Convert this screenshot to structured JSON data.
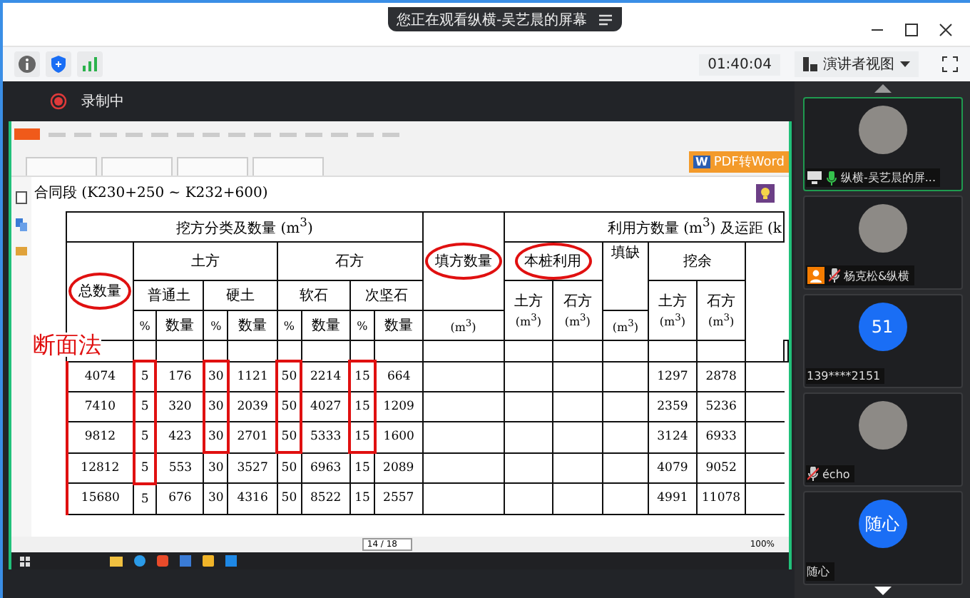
{
  "banner": {
    "text": "您正在观看纵横-吴艺晨的屏幕"
  },
  "toolbar": {
    "timer": "01:40:04",
    "view_button": "演讲者视图"
  },
  "recording": {
    "label": "录制中"
  },
  "shared_screen": {
    "pdf_button": "PDF转Word",
    "pdf_icon": "W",
    "doc_title": "合同段 (K230+250 ~ K232+600)",
    "annotation": "断面法",
    "page": "14 / 18",
    "zoom": "100%",
    "table": {
      "title_excavation": "挖方分类及数量 (m$^{3}$)",
      "title_fill": "填方数量",
      "title_use": "利用方数量 (m$^{3}$) 及运距 (k",
      "total": "总数量",
      "total_circled": true,
      "fill_circled": true,
      "fill_unit": "(m$^{3}$)",
      "groups": [
        {
          "name": "土方",
          "types": [
            {
              "name": "普通土",
              "pct": "%",
              "qty": "数量"
            },
            {
              "name": "硬土",
              "pct": "%",
              "qty": "数量"
            }
          ]
        },
        {
          "name": "石方",
          "types": [
            {
              "name": "软石",
              "pct": "%",
              "qty": "数量"
            },
            {
              "name": "次坚石",
              "pct": "%",
              "qty": "数量"
            }
          ]
        }
      ],
      "use_own": {
        "name": "本桩利用",
        "circled": true,
        "cols": [
          {
            "name": "土方",
            "unit": "(m$^{3}$)"
          },
          {
            "name": "石方",
            "unit": "(m$^{3}$)"
          }
        ]
      },
      "use_gap": {
        "name": "填缺",
        "unit": "(m$^{3}$)"
      },
      "use_surplus": {
        "name": "挖余",
        "cols": [
          {
            "name": "土方",
            "unit": "(m$^{3}$)"
          },
          {
            "name": "石方",
            "unit": "(m$^{3}$)"
          }
        ]
      },
      "rows": [
        {
          "total": "4074",
          "parts": [
            {
              "pct": "5",
              "qty": "176",
              "circled": true
            },
            {
              "pct": "30",
              "qty": "1121",
              "circled": true
            },
            {
              "pct": "50",
              "qty": "2214",
              "circled": true
            },
            {
              "pct": "15",
              "qty": "664",
              "circled": true
            }
          ],
          "surplus": [
            "1297",
            "2878"
          ]
        },
        {
          "total": "7410",
          "parts": [
            {
              "pct": "5",
              "qty": "320",
              "circled": true
            },
            {
              "pct": "30",
              "qty": "2039",
              "circled": true
            },
            {
              "pct": "50",
              "qty": "4027",
              "circled": true
            },
            {
              "pct": "15",
              "qty": "1209",
              "circled": true
            }
          ],
          "surplus": [
            "2359",
            "5236"
          ]
        },
        {
          "total": "9812",
          "parts": [
            {
              "pct": "5",
              "qty": "423",
              "circled": true
            },
            {
              "pct": "30",
              "qty": "2701",
              "circled": true
            },
            {
              "pct": "50",
              "qty": "5333",
              "circled": true
            },
            {
              "pct": "15",
              "qty": "1600",
              "circled": true
            }
          ],
          "surplus": [
            "3124",
            "6933"
          ]
        },
        {
          "total": "12812",
          "parts": [
            {
              "pct": "5",
              "qty": "553",
              "circled": true
            },
            {
              "pct": "30",
              "qty": "3527",
              "circled": false
            },
            {
              "pct": "50",
              "qty": "6963",
              "circled": false
            },
            {
              "pct": "15",
              "qty": "2089",
              "circled": false
            }
          ],
          "surplus": [
            "4079",
            "9052"
          ]
        },
        {
          "total": "15680",
          "parts": [
            {
              "pct": "5",
              "qty": "676",
              "circled": false
            },
            {
              "pct": "30",
              "qty": "4316",
              "circled": false
            },
            {
              "pct": "50",
              "qty": "8522",
              "circled": false
            },
            {
              "pct": "15",
              "qty": "2557",
              "circled": false
            }
          ],
          "surplus": [
            "4991",
            "11078"
          ]
        }
      ]
    }
  },
  "participants": [
    {
      "name": "纵横-吴艺晨的屏...",
      "kind": "photo",
      "mic_visible": true,
      "muted": false,
      "sharing": true,
      "host": false,
      "selected": true
    },
    {
      "name": "杨克松&纵横",
      "kind": "photo",
      "mic_visible": true,
      "muted": true,
      "sharing": false,
      "host": true,
      "selected": false
    },
    {
      "name": "139****2151",
      "kind": "initials",
      "initials": "51",
      "mic_visible": false,
      "sharing": false,
      "host": false,
      "selected": false
    },
    {
      "name": "écho",
      "kind": "photo",
      "mic_visible": true,
      "muted": true,
      "sharing": false,
      "host": false,
      "selected": false
    },
    {
      "name": "随心",
      "kind": "initials",
      "initials": "随心",
      "mic_visible": false,
      "sharing": false,
      "host": false,
      "selected": false
    }
  ]
}
